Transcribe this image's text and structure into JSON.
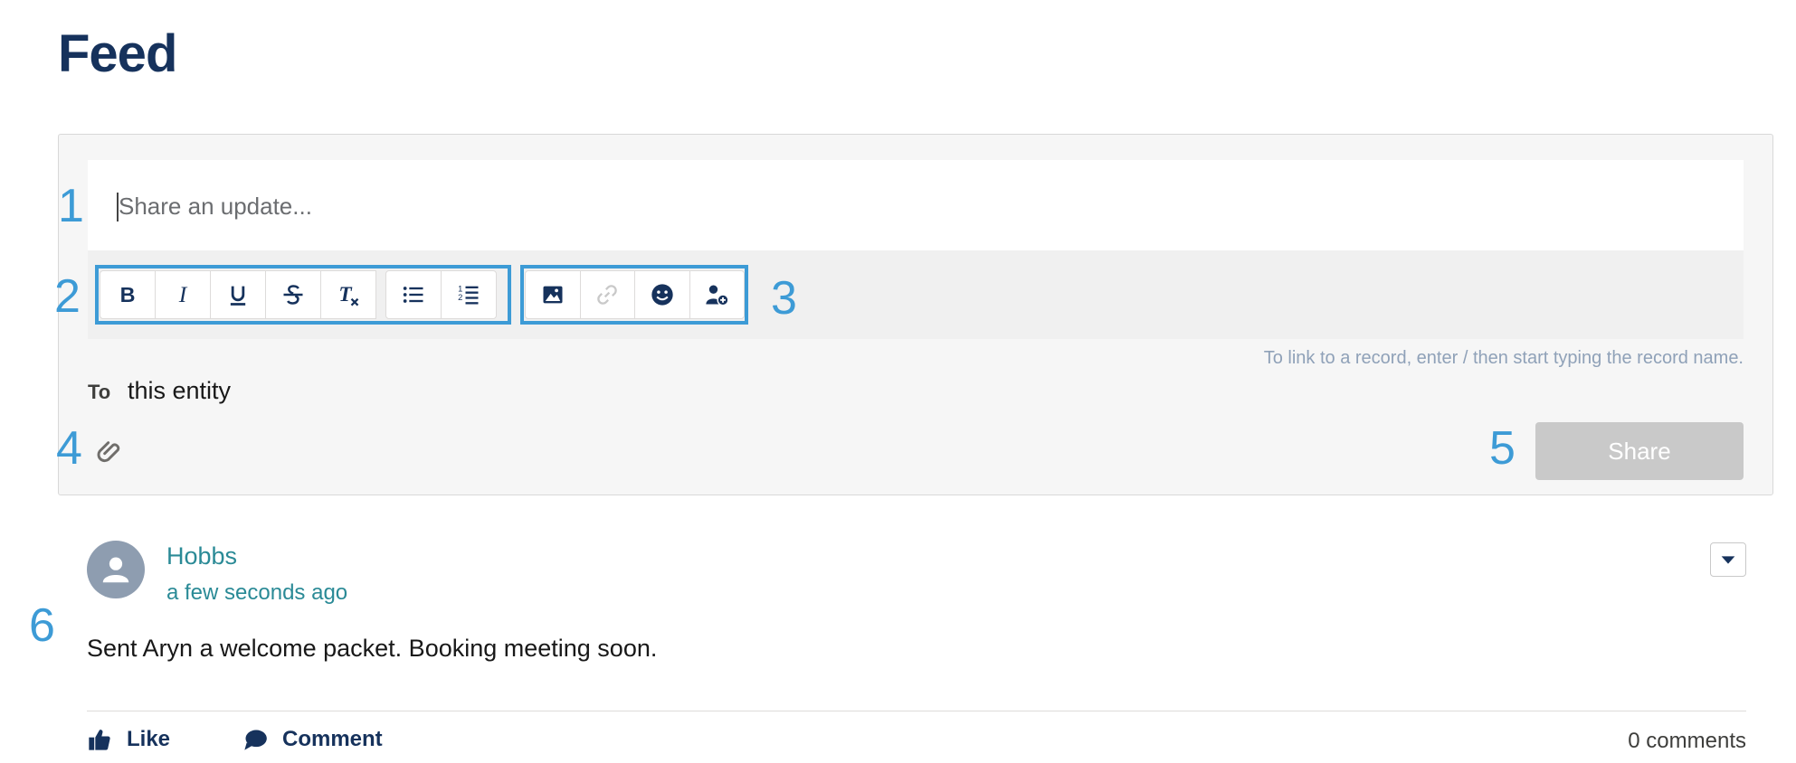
{
  "page": {
    "title": "Feed"
  },
  "publisher": {
    "placeholder": "Share an update...",
    "hint": "To link to a record, enter / then start typing the record name.",
    "to_label": "To",
    "to_value": "this entity",
    "share_label": "Share",
    "toolbar": {
      "formatting": [
        {
          "name": "bold",
          "icon": "bold-icon"
        },
        {
          "name": "italic",
          "icon": "italic-icon"
        },
        {
          "name": "underline",
          "icon": "underline-icon"
        },
        {
          "name": "strikethrough",
          "icon": "strikethrough-icon"
        },
        {
          "name": "remove-formatting",
          "icon": "remove-format-icon"
        },
        {
          "name": "bulleted-list",
          "icon": "bulleted-list-icon"
        },
        {
          "name": "numbered-list",
          "icon": "numbered-list-icon"
        }
      ],
      "insert": [
        {
          "name": "image",
          "icon": "image-icon"
        },
        {
          "name": "link",
          "icon": "link-icon",
          "disabled": true
        },
        {
          "name": "emoji",
          "icon": "emoji-icon"
        },
        {
          "name": "mention",
          "icon": "add-user-icon"
        }
      ]
    }
  },
  "callouts": [
    "1",
    "2",
    "3",
    "4",
    "5",
    "6"
  ],
  "post": {
    "author": "Hobbs",
    "time": "a few seconds ago",
    "body": "Sent Aryn a welcome packet. Booking meeting soon.",
    "like_label": "Like",
    "comment_label": "Comment",
    "comment_count": "0 comments"
  },
  "colors": {
    "brand_navy": "#16325c",
    "callout_blue": "#3d9bd6",
    "author_teal": "#2a8a96",
    "share_disabled": "#c9c9c9"
  }
}
